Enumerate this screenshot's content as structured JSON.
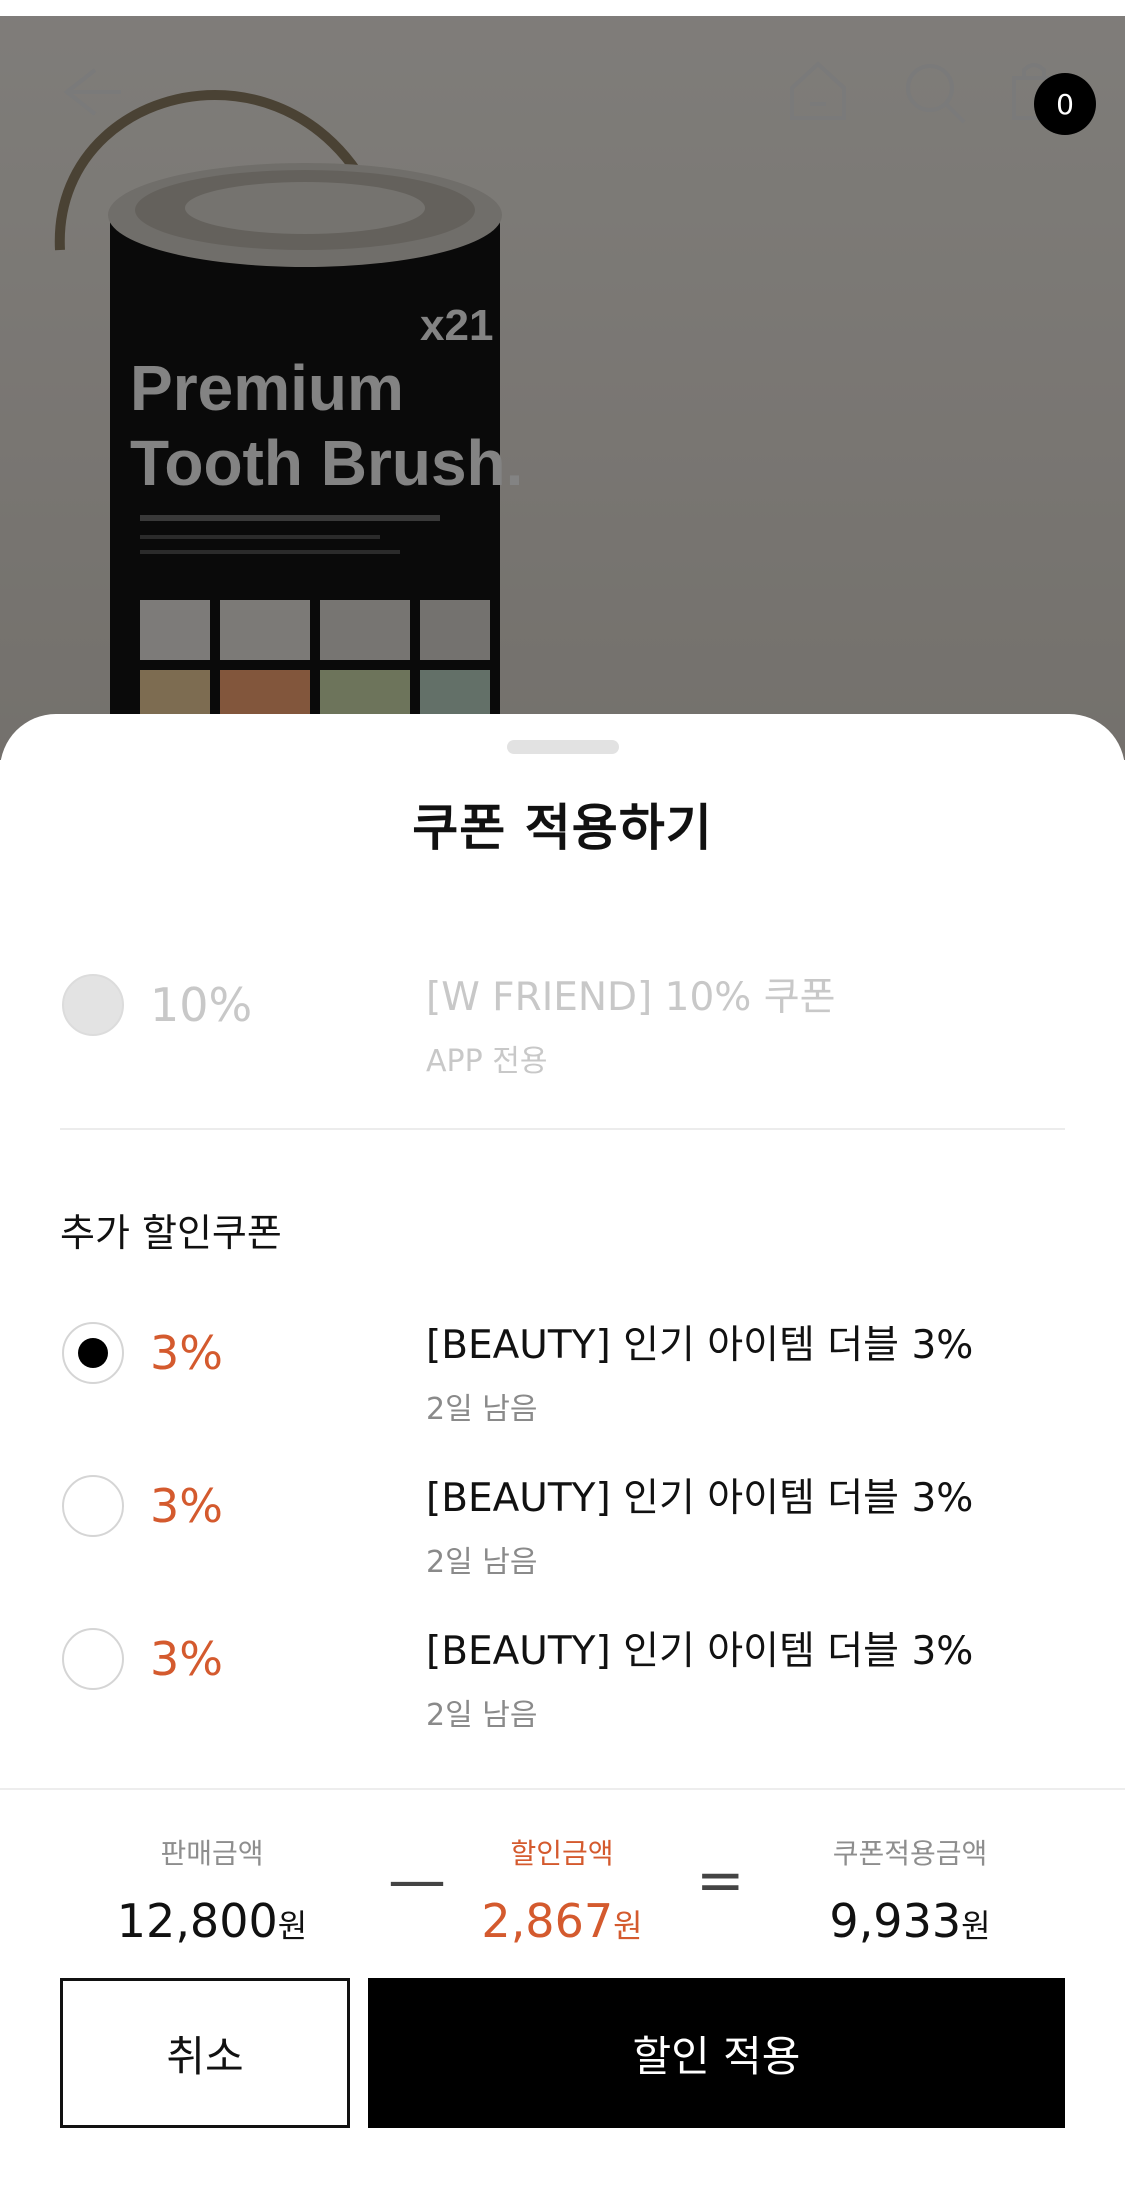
{
  "header": {
    "back_icon": "back-arrow-icon",
    "home_icon": "home-icon",
    "search_icon": "search-icon",
    "cart_icon": "shopping-bag-icon",
    "cart_count": "0"
  },
  "product_image": {
    "brand_line1": "Premium",
    "brand_line2": "Tooth Brush.",
    "count": "x21"
  },
  "sheet": {
    "title": "쿠폰 적용하기",
    "disabled_coupon": {
      "percent": "10%",
      "name": "[W FRIEND] 10% 쿠폰",
      "note": "APP 전용"
    },
    "additional_section_title": "추가 할인쿠폰",
    "coupons": [
      {
        "percent": "3%",
        "name": "[BEAUTY] 인기 아이템 더블 3%",
        "remaining": "2일 남음",
        "selected": true
      },
      {
        "percent": "3%",
        "name": "[BEAUTY] 인기 아이템 더블 3%",
        "remaining": "2일 남음",
        "selected": false
      },
      {
        "percent": "3%",
        "name": "[BEAUTY] 인기 아이템 더블 3%",
        "remaining": "2일 남음",
        "selected": false
      }
    ]
  },
  "summary": {
    "sale_label": "판매금액",
    "sale_amount": "12,800",
    "minus": "—",
    "discount_label": "할인금액",
    "discount_amount": "2,867",
    "equals": "=",
    "final_label": "쿠폰적용금액",
    "final_amount": "9,933",
    "currency": "원"
  },
  "buttons": {
    "cancel": "취소",
    "apply": "할인 적용"
  },
  "colors": {
    "accent": "#d45a2e",
    "primary": "#000000",
    "disabled": "#c8c8c8"
  }
}
